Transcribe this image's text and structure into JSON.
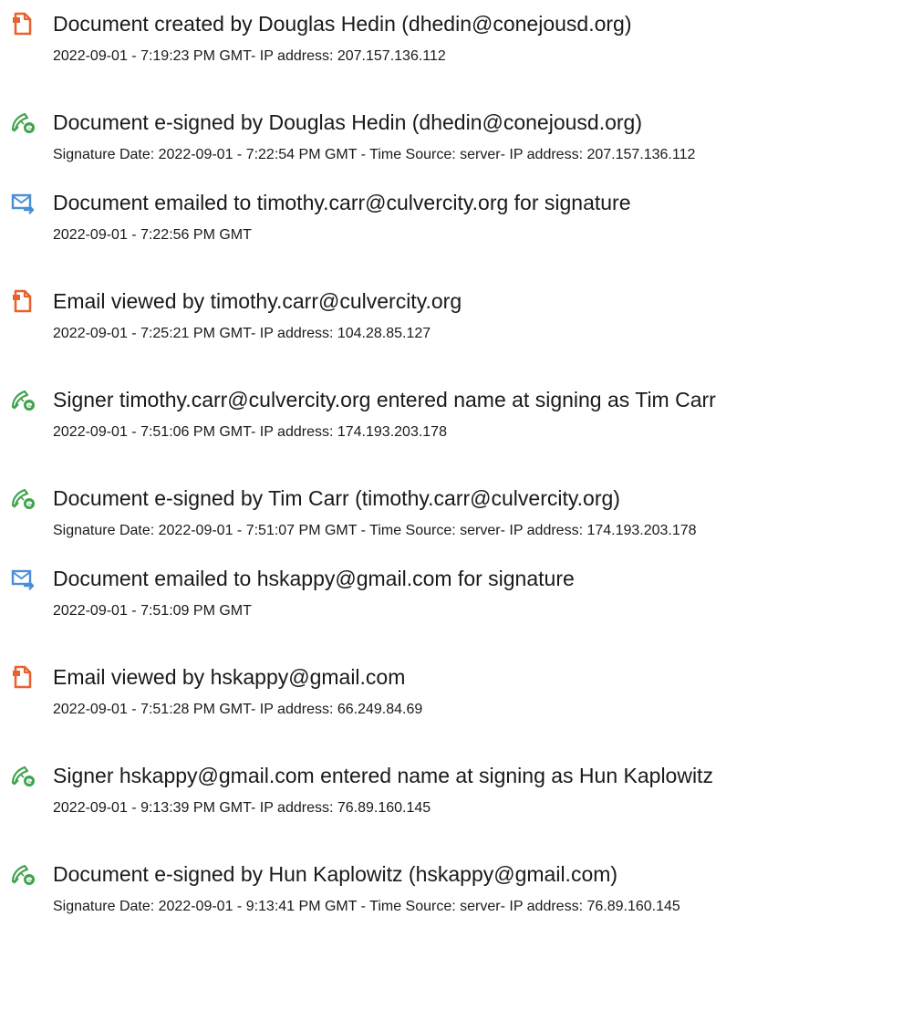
{
  "entries": [
    {
      "icon": "document-created-icon",
      "title": "Document created by Douglas Hedin (dhedin@conejousd.org)",
      "detail": "2022-09-01 - 7:19:23 PM GMT- IP address: 207.157.136.112"
    },
    {
      "icon": "e-sign-pen-icon",
      "title": "Document e-signed by Douglas Hedin (dhedin@conejousd.org)",
      "detail": "Signature Date: 2022-09-01 - 7:22:54 PM GMT - Time Source: server- IP address: 207.157.136.112"
    },
    {
      "icon": "email-sent-icon",
      "title": "Document emailed to timothy.carr@culvercity.org for signature",
      "detail": "2022-09-01 - 7:22:56 PM GMT"
    },
    {
      "icon": "document-viewed-icon",
      "title": "Email viewed by timothy.carr@culvercity.org",
      "detail": "2022-09-01 - 7:25:21 PM GMT- IP address: 104.28.85.127"
    },
    {
      "icon": "e-sign-pen-icon",
      "title": "Signer timothy.carr@culvercity.org entered name at signing as Tim Carr",
      "detail": "2022-09-01 - 7:51:06 PM GMT- IP address: 174.193.203.178"
    },
    {
      "icon": "e-sign-pen-icon",
      "title": "Document e-signed by Tim Carr (timothy.carr@culvercity.org)",
      "detail": "Signature Date: 2022-09-01 - 7:51:07 PM GMT - Time Source: server- IP address: 174.193.203.178"
    },
    {
      "icon": "email-sent-icon",
      "title": "Document emailed to hskappy@gmail.com for signature",
      "detail": "2022-09-01 - 7:51:09 PM GMT"
    },
    {
      "icon": "document-viewed-icon",
      "title": "Email viewed by hskappy@gmail.com",
      "detail": "2022-09-01 - 7:51:28 PM GMT- IP address: 66.249.84.69"
    },
    {
      "icon": "e-sign-pen-icon",
      "title": "Signer hskappy@gmail.com entered name at signing as Hun Kaplowitz",
      "detail": "2022-09-01 - 9:13:39 PM GMT- IP address: 76.89.160.145"
    },
    {
      "icon": "e-sign-pen-icon",
      "title": "Document e-signed by Hun Kaplowitz (hskappy@gmail.com)",
      "detail": "Signature Date: 2022-09-01 - 9:13:41 PM GMT - Time Source: server- IP address: 76.89.160.145"
    }
  ],
  "colors": {
    "document_icon": "#e8622f",
    "pen_icon": "#3fa34d",
    "mail_icon": "#4a8fd6",
    "text": "#1a1a1a"
  }
}
